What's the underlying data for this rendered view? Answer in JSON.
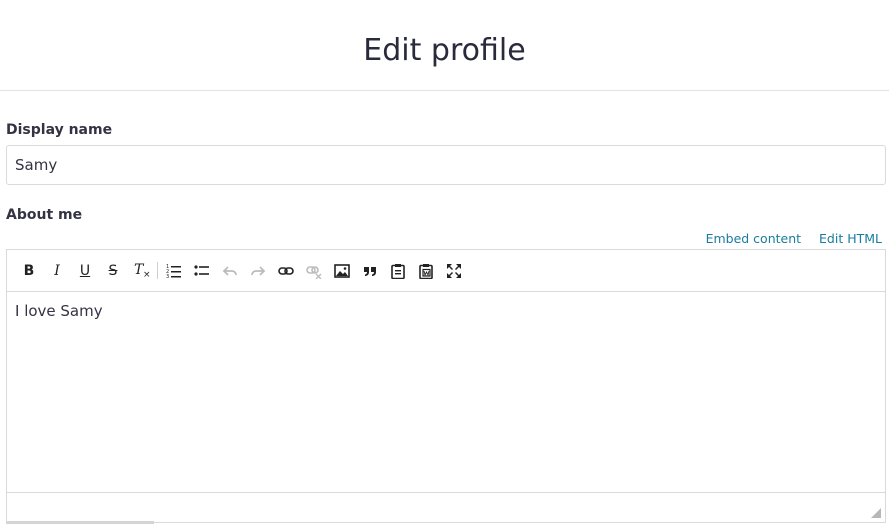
{
  "page": {
    "title": "Edit profile"
  },
  "form": {
    "display_name": {
      "label": "Display name",
      "value": "Samy"
    },
    "about_me": {
      "label": "About me",
      "links": {
        "embed": "Embed content",
        "edit_html": "Edit HTML"
      },
      "content": "I love Samy"
    }
  },
  "toolbar": {
    "buttons": [
      {
        "name": "bold",
        "icon": "bold-icon",
        "glyph": "B",
        "enabled": true
      },
      {
        "name": "italic",
        "icon": "italic-icon",
        "glyph": "I",
        "enabled": true
      },
      {
        "name": "underline",
        "icon": "underline-icon",
        "glyph": "U",
        "enabled": true
      },
      {
        "name": "strikethrough",
        "icon": "strikethrough-icon",
        "glyph": "S",
        "enabled": true
      },
      {
        "name": "clear-formatting",
        "icon": "clear-formatting-icon",
        "glyph": "T",
        "enabled": true
      },
      {
        "name": "ordered-list",
        "icon": "ordered-list-icon",
        "enabled": true
      },
      {
        "name": "bullet-list",
        "icon": "bullet-list-icon",
        "enabled": true
      },
      {
        "name": "undo",
        "icon": "undo-icon",
        "enabled": false
      },
      {
        "name": "redo",
        "icon": "redo-icon",
        "enabled": false
      },
      {
        "name": "link",
        "icon": "link-icon",
        "enabled": true
      },
      {
        "name": "unlink",
        "icon": "unlink-icon",
        "enabled": false
      },
      {
        "name": "image",
        "icon": "image-icon",
        "enabled": true
      },
      {
        "name": "blockquote",
        "icon": "quote-icon",
        "enabled": true
      },
      {
        "name": "paste",
        "icon": "paste-icon",
        "enabled": true
      },
      {
        "name": "paste-word",
        "icon": "paste-word-icon",
        "enabled": true
      },
      {
        "name": "fullscreen",
        "icon": "fullscreen-icon",
        "enabled": true
      }
    ]
  },
  "colors": {
    "link": "#1a7c9e",
    "text": "#333344",
    "border": "#d9dadc",
    "disabled_icon": "#bbbbbb"
  }
}
